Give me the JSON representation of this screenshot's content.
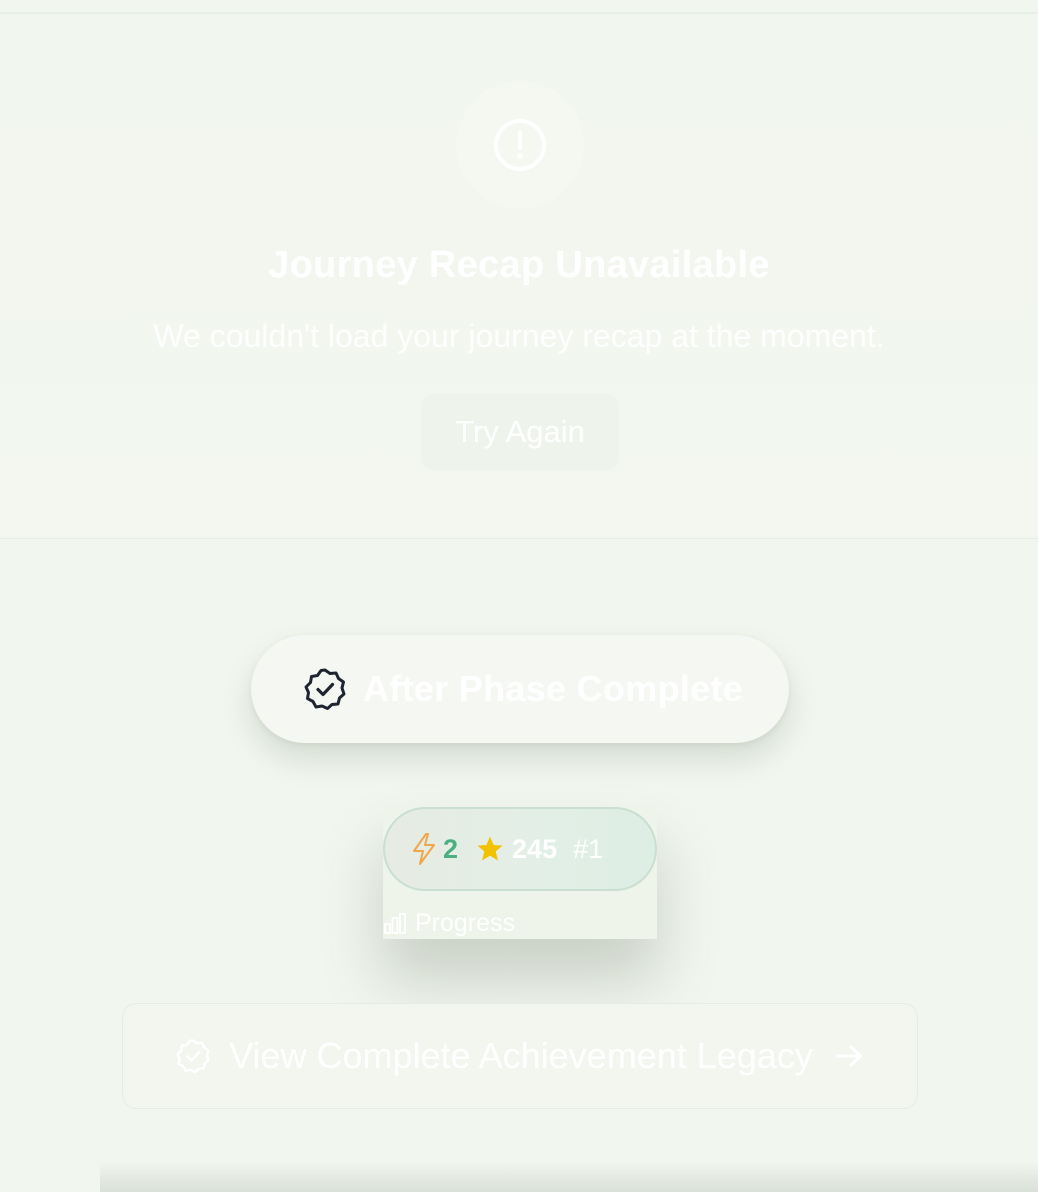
{
  "error": {
    "title": "Journey Recap Unavailable",
    "message": "We couldn't load your journey recap at the moment.",
    "retry_label": "Try Again",
    "icon": "alert-circle-icon"
  },
  "phase": {
    "label": "After Phase Complete",
    "icon": "badge-check-icon"
  },
  "stats": {
    "streak_value": "2",
    "points_value": "245",
    "rank_value": "#1",
    "progress_label": "Progress",
    "streak_icon": "lightning-icon",
    "points_icon": "star-icon",
    "progress_icon": "bar-chart-icon"
  },
  "legacy": {
    "label": "View Complete Achievement Legacy",
    "icon": "badge-check-icon",
    "arrow_icon": "arrow-right-icon"
  },
  "colors": {
    "background": "#f1f6ee",
    "streak_green": "#4caf7f",
    "star_yellow": "#f2c200",
    "lightning_orange": "#f0a64a"
  }
}
